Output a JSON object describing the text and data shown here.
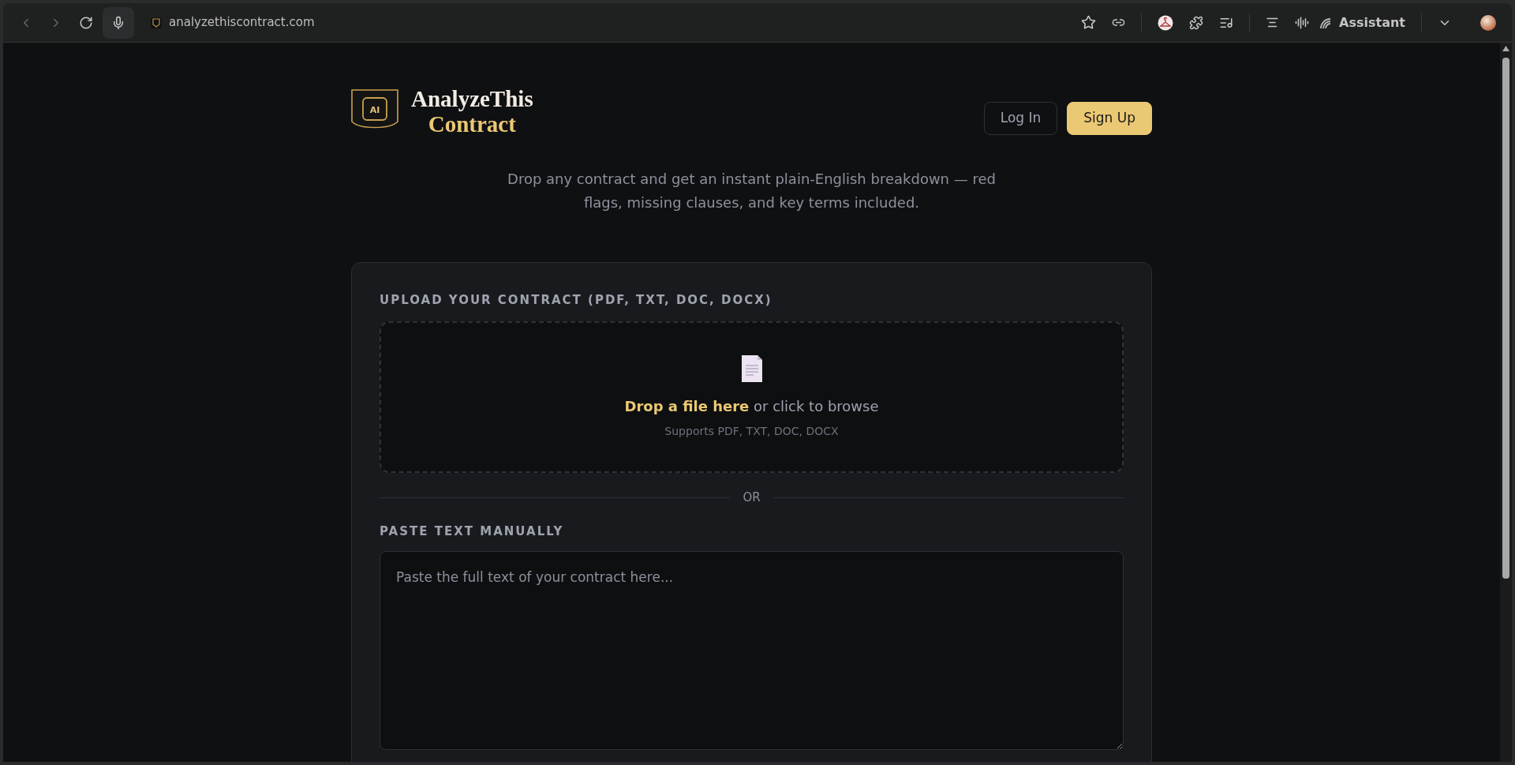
{
  "browser": {
    "url": "analyzethiscontract.com",
    "assistant_label": "Assistant"
  },
  "header": {
    "logo_badge": "AI",
    "logo_line_1": "AnalyzeThis",
    "logo_line_2": "Contract",
    "buttons": [
      {
        "label": "Log In",
        "kind": "outline"
      },
      {
        "label": "Sign Up",
        "kind": "primary"
      }
    ]
  },
  "tagline": "Drop any contract and get an instant plain-English breakdown — red flags, missing clauses, and key terms included.",
  "upload": {
    "label": "UPLOAD YOUR CONTRACT (PDF, TXT, DOC, DOCX)",
    "drop_text": "**Drop a file here** or click to browse",
    "supports": "Supports PDF, TXT, DOC, DOCX"
  },
  "divider": "OR",
  "paste": {
    "label": "PASTE TEXT MANUALLY",
    "placeholder": "Paste the full text of your contract here..."
  }
}
